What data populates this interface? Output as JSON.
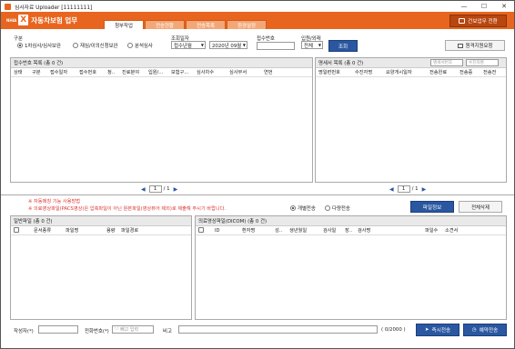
{
  "window": {
    "title": "심사자료 Uploader [11111111]",
    "minimize": "—",
    "maximize": "☐",
    "close": "✕"
  },
  "header": {
    "logo_small": "NHIA",
    "logo_mark": "X",
    "app_name": "자동차보험 업무",
    "tabs": [
      "청부작업",
      "전송현황",
      "전송목록",
      "환경설정"
    ],
    "switch_button": "건보업무 전환"
  },
  "filters": {
    "category_label": "구분",
    "radios": [
      {
        "label": "1차심사/심사보완",
        "checked": true
      },
      {
        "label": "재심/이의신청보완",
        "checked": false
      },
      {
        "label": "분석심사",
        "checked": false
      }
    ],
    "period_label": "조회일자",
    "period_type": "접수년월",
    "period_value": "2020년 09월",
    "receipt_label": "접수번호",
    "receipt_value": "",
    "inout_label": "입원/외래",
    "inout_value": "전체",
    "search_button": "조회",
    "remote_button": "원격지원요청"
  },
  "receipt_panel": {
    "title": "접수번호 목록 (총 0 건)",
    "columns": [
      "상태",
      "구분",
      "접수일자",
      "접수번호",
      "청..",
      "진료분야",
      "입원/...",
      "보험구...",
      "심사차수",
      "심사부서",
      "연번"
    ],
    "page": "1",
    "total_pages": "/ 1"
  },
  "detail_panel": {
    "title": "명세서 목록 (총 0 건)",
    "search_placeholder_1": "명세서번호",
    "search_placeholder_2": "수진자명",
    "columns": [
      "명일련번호",
      "수진자명",
      "요양개시일자",
      "전송완료",
      "전송중",
      "전송전"
    ],
    "page": "1",
    "total_pages": "/ 1"
  },
  "notes": {
    "line1": "※ 자동매칭 기능 사용방법",
    "line2": "※ 의료영상파일(PACS영상)은 압축파일이 아닌 원본파일(영상뷰어 제외)로 제출해 주시기 바랍니다."
  },
  "transfer": {
    "radios": [
      {
        "label": "개별전송",
        "checked": true
      },
      {
        "label": "다량전송",
        "checked": false
      }
    ],
    "file_info_button": "파일정보",
    "delete_all_button": "전체삭제"
  },
  "general_panel": {
    "title": "일반파일 (총 0 건)",
    "columns": [
      "",
      "문서종류",
      "파일명",
      "용량",
      "파일경로"
    ]
  },
  "dicom_panel": {
    "title": "의료영상파일(DICOM) (총 0 건)",
    "columns": [
      "",
      "ID",
      "환자명",
      "성..",
      "생년월일",
      "검사일",
      "장..",
      "검사명",
      "파일수",
      "소견서"
    ]
  },
  "footer": {
    "writer_label": "작성자(*)",
    "writer_value": "",
    "phone_label": "전화번호(*)",
    "phone_placeholder": "'-' 빼고 입력",
    "remark_label": "비고",
    "remark_value": "",
    "char_count": "( 0/2000 )",
    "send_now_button": "즉시전송",
    "reserve_button": "예약전송"
  },
  "colors": {
    "accent": "#e8651f",
    "primary": "#2a57a0",
    "note": "#dd3333"
  }
}
